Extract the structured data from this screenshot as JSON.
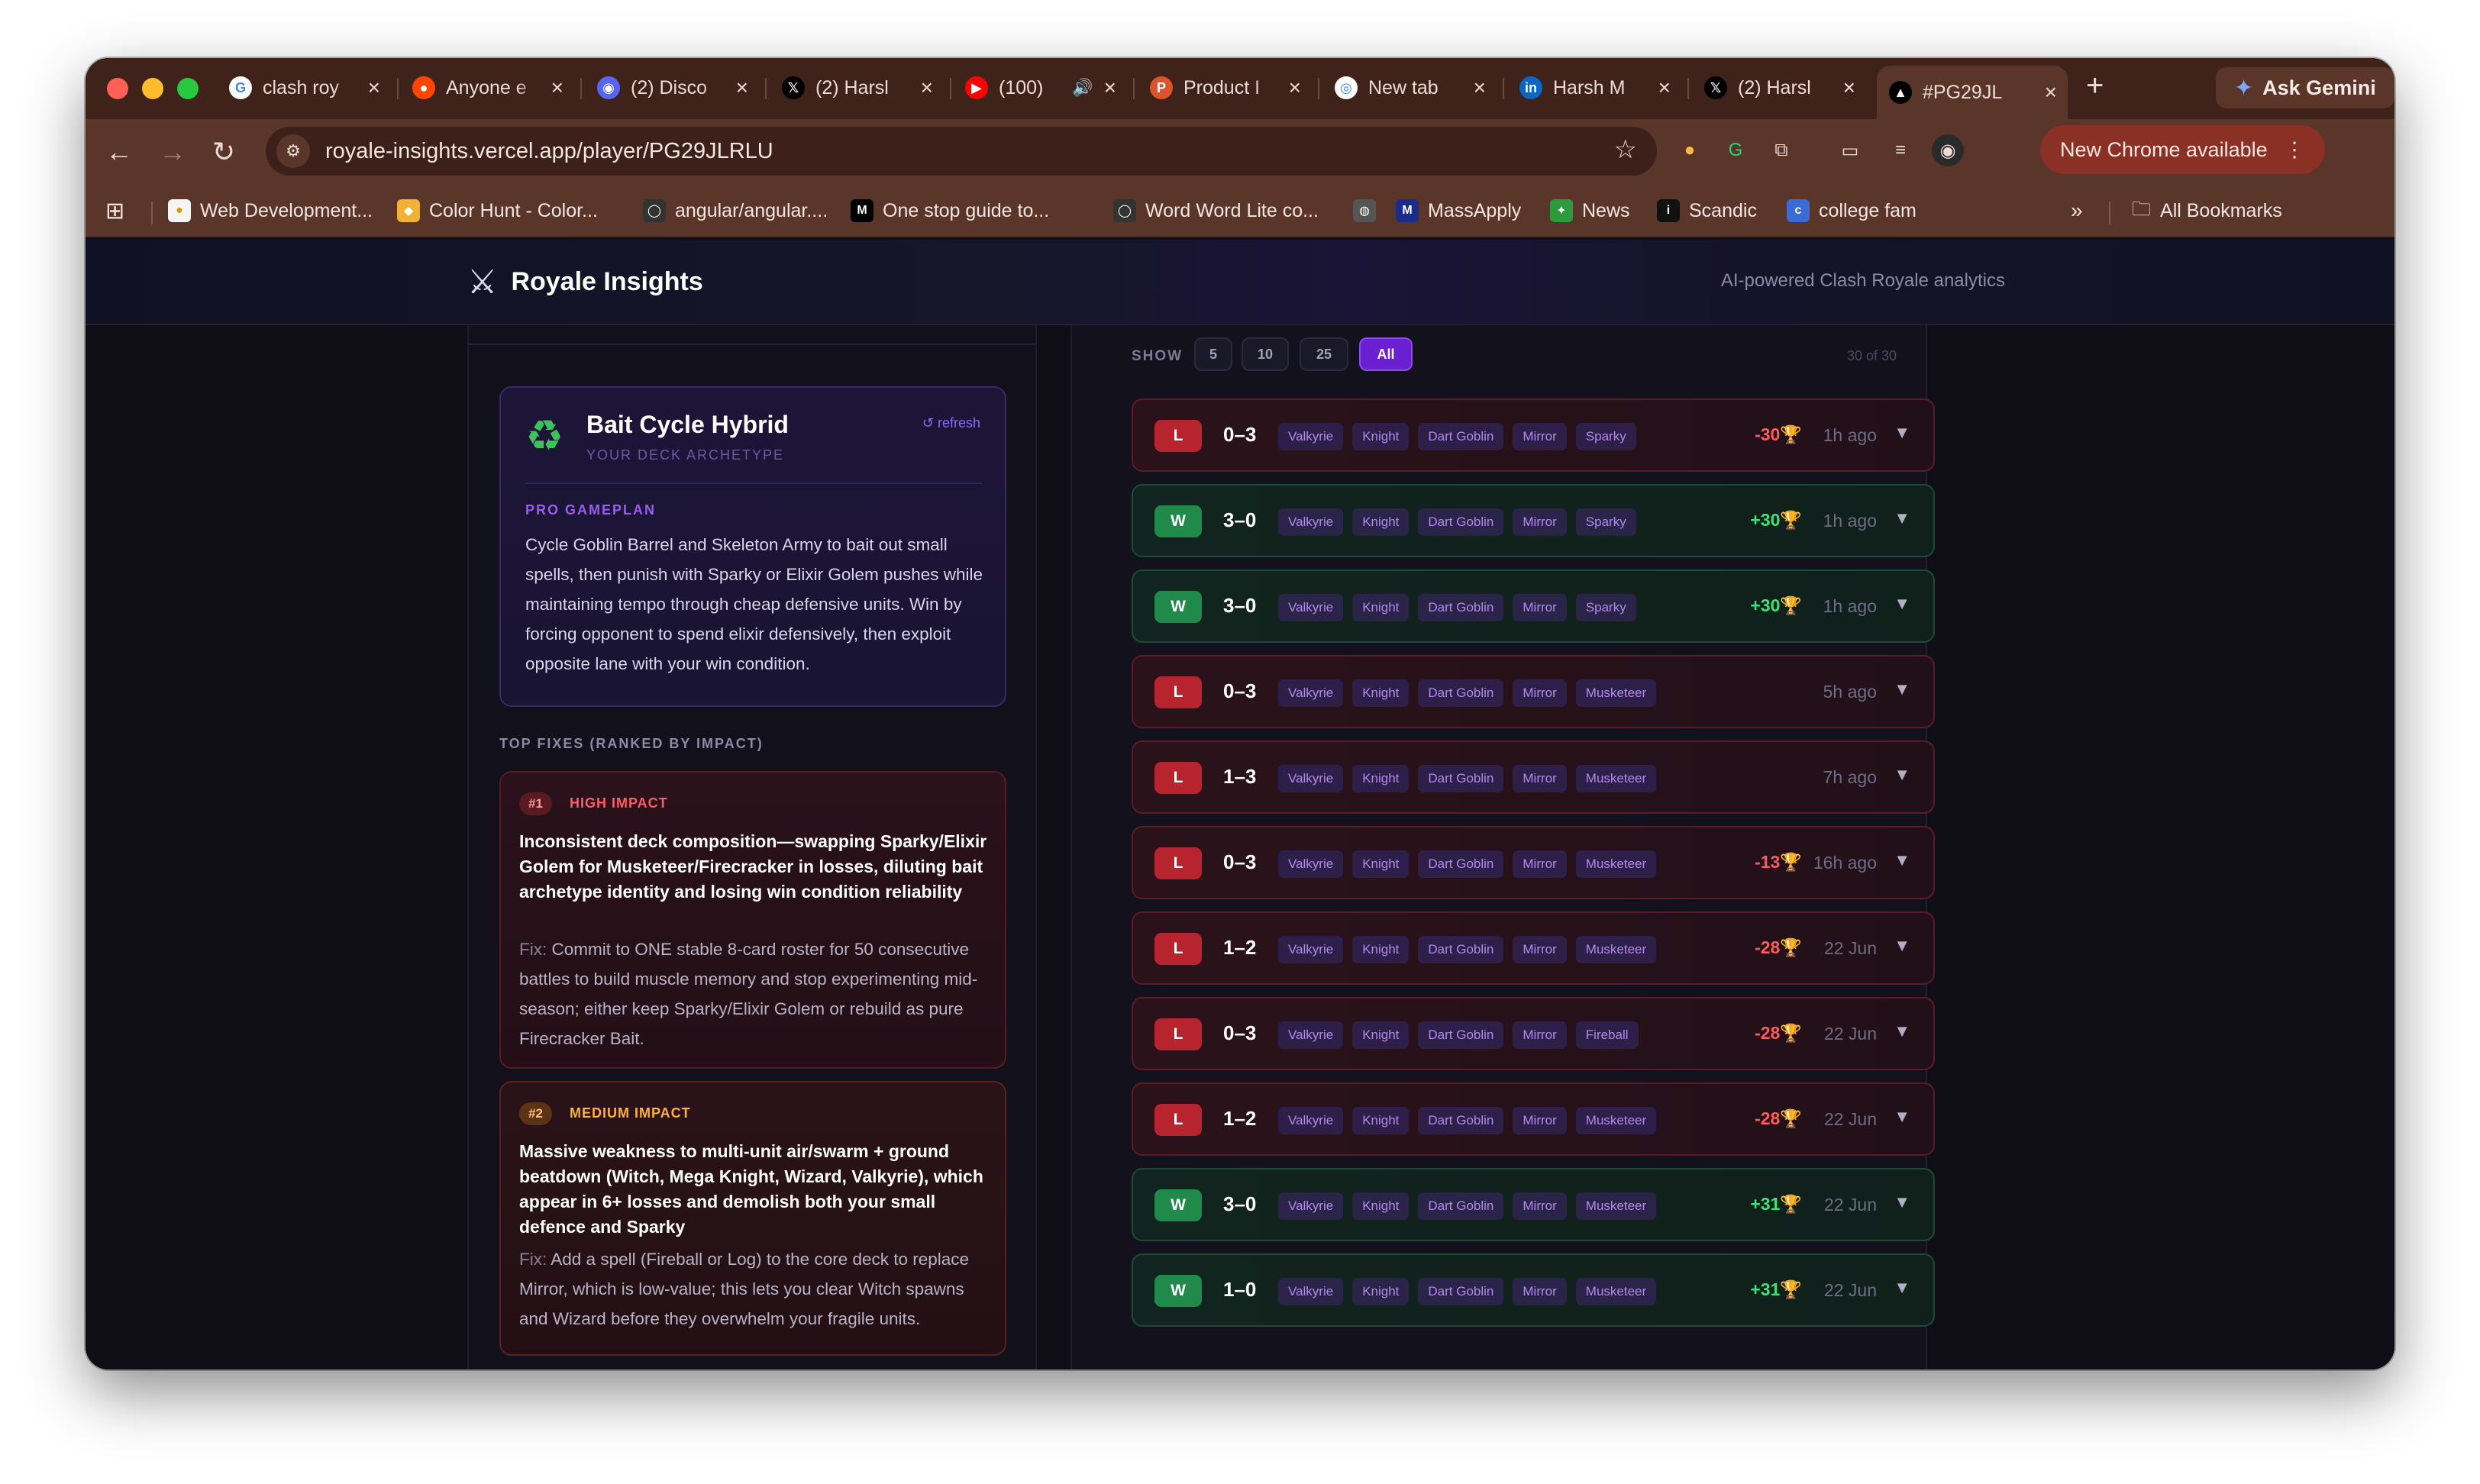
{
  "browser": {
    "tabs": [
      {
        "title": "clash roy",
        "icon": "google-icon",
        "color": "#ffffff"
      },
      {
        "title": "Anyone e",
        "icon": "reddit-icon",
        "color": "#ff4500"
      },
      {
        "title": "(2) Disco",
        "icon": "discord-icon",
        "color": "#5865f2"
      },
      {
        "title": "(2) Harsl",
        "icon": "x-icon",
        "color": "#000000"
      },
      {
        "title": "(100)",
        "icon": "youtube-icon",
        "color": "#ff0000"
      },
      {
        "title": "Product I",
        "icon": "producthunt-icon",
        "color": "#da552f"
      },
      {
        "title": "New tab",
        "icon": "chrome-icon",
        "color": "#ffffff"
      },
      {
        "title": "Harsh M",
        "icon": "linkedin-icon",
        "color": "#0a66c2"
      },
      {
        "title": "(2) Harsl",
        "icon": "x-icon",
        "color": "#000000"
      },
      {
        "title": "#PG29JL",
        "icon": "vercel-icon",
        "color": "#000000"
      }
    ],
    "gemini_label": "Ask Gemini",
    "url": "royale-insights.vercel.app/player/PG29JLRLU",
    "chrome_update_label": "New Chrome available",
    "bookmarks": [
      {
        "label": "Web Development...",
        "icon": "bookmark-favicon"
      },
      {
        "label": "Color Hunt - Color...",
        "icon": "colorhunt-icon"
      },
      {
        "label": "angular/angular....",
        "icon": "github-icon"
      },
      {
        "label": "One stop guide to...",
        "icon": "medium-icon"
      },
      {
        "label": "Word Word Lite co...",
        "icon": "github-icon"
      },
      {
        "label": "",
        "icon": "globe-icon"
      },
      {
        "label": "MassApply",
        "icon": "massapply-icon"
      },
      {
        "label": "News",
        "icon": "news-icon"
      },
      {
        "label": "Scandic",
        "icon": "scandic-icon"
      },
      {
        "label": "college fam",
        "icon": "collegefam-icon"
      }
    ],
    "all_bookmarks_label": "All Bookmarks"
  },
  "app": {
    "brand": "Royale Insights",
    "tagline": "AI-powered Clash Royale analytics"
  },
  "archetype": {
    "title": "Bait Cycle Hybrid",
    "subtitle": "YOUR DECK ARCHETYPE",
    "refresh_label": "↺ refresh",
    "gameplan_label": "PRO GAMEPLAN",
    "gameplan": "Cycle Goblin Barrel and Skeleton Army to bait out small spells, then punish with Sparky or Elixir Golem pushes while maintaining tempo through cheap defensive units. Win by forcing opponent to spend elixir defensively, then exploit opposite lane with your win condition."
  },
  "fixes": {
    "label": "TOP FIXES (RANKED BY IMPACT)",
    "items": [
      {
        "rank": "#1",
        "impact": "HIGH IMPACT",
        "title": "Inconsistent deck composition—swapping Sparky/Elixir Golem for Musketeer/Firecracker in losses, diluting bait archetype identity and losing win condition reliability",
        "fix_prefix": "Fix:",
        "fix": "Commit to ONE stable 8-card roster for 50 consecutive battles to build muscle memory and stop experimenting mid-season; either keep Sparky/Elixir Golem or rebuild as pure Firecracker Bait."
      },
      {
        "rank": "#2",
        "impact": "MEDIUM IMPACT",
        "title": "Massive weakness to multi-unit air/swarm + ground beatdown (Witch, Mega Knight, Wizard, Valkyrie), which appear in 6+ losses and demolish both your small defence and Sparky",
        "fix_prefix": "Fix:",
        "fix": "Add a spell (Fireball or Log) to the core deck to replace Mirror, which is low-value; this lets you clear Witch spawns and Wizard before they overwhelm your fragile units."
      }
    ]
  },
  "battles": {
    "show_label": "SHOW",
    "show_options": [
      "5",
      "10",
      "25",
      "All"
    ],
    "active_option": "All",
    "count_label": "30 of 30",
    "list": [
      {
        "result": "L",
        "score": "0–3",
        "cards": [
          "Valkyrie",
          "Knight",
          "Dart Goblin",
          "Mirror",
          "Sparky"
        ],
        "trophies": "-30🏆",
        "time": "1h ago"
      },
      {
        "result": "W",
        "score": "3–0",
        "cards": [
          "Valkyrie",
          "Knight",
          "Dart Goblin",
          "Mirror",
          "Sparky"
        ],
        "trophies": "+30🏆",
        "time": "1h ago"
      },
      {
        "result": "W",
        "score": "3–0",
        "cards": [
          "Valkyrie",
          "Knight",
          "Dart Goblin",
          "Mirror",
          "Sparky"
        ],
        "trophies": "+30🏆",
        "time": "1h ago"
      },
      {
        "result": "L",
        "score": "0–3",
        "cards": [
          "Valkyrie",
          "Knight",
          "Dart Goblin",
          "Mirror",
          "Musketeer"
        ],
        "trophies": "",
        "time": "5h ago"
      },
      {
        "result": "L",
        "score": "1–3",
        "cards": [
          "Valkyrie",
          "Knight",
          "Dart Goblin",
          "Mirror",
          "Musketeer"
        ],
        "trophies": "",
        "time": "7h ago"
      },
      {
        "result": "L",
        "score": "0–3",
        "cards": [
          "Valkyrie",
          "Knight",
          "Dart Goblin",
          "Mirror",
          "Musketeer"
        ],
        "trophies": "-13🏆",
        "time": "16h ago"
      },
      {
        "result": "L",
        "score": "1–2",
        "cards": [
          "Valkyrie",
          "Knight",
          "Dart Goblin",
          "Mirror",
          "Musketeer"
        ],
        "trophies": "-28🏆",
        "time": "22 Jun"
      },
      {
        "result": "L",
        "score": "0–3",
        "cards": [
          "Valkyrie",
          "Knight",
          "Dart Goblin",
          "Mirror",
          "Fireball"
        ],
        "trophies": "-28🏆",
        "time": "22 Jun"
      },
      {
        "result": "L",
        "score": "1–2",
        "cards": [
          "Valkyrie",
          "Knight",
          "Dart Goblin",
          "Mirror",
          "Musketeer"
        ],
        "trophies": "-28🏆",
        "time": "22 Jun"
      },
      {
        "result": "W",
        "score": "3–0",
        "cards": [
          "Valkyrie",
          "Knight",
          "Dart Goblin",
          "Mirror",
          "Musketeer"
        ],
        "trophies": "+31🏆",
        "time": "22 Jun"
      },
      {
        "result": "W",
        "score": "1–0",
        "cards": [
          "Valkyrie",
          "Knight",
          "Dart Goblin",
          "Mirror",
          "Musketeer"
        ],
        "trophies": "+31🏆",
        "time": "22 Jun"
      }
    ]
  }
}
